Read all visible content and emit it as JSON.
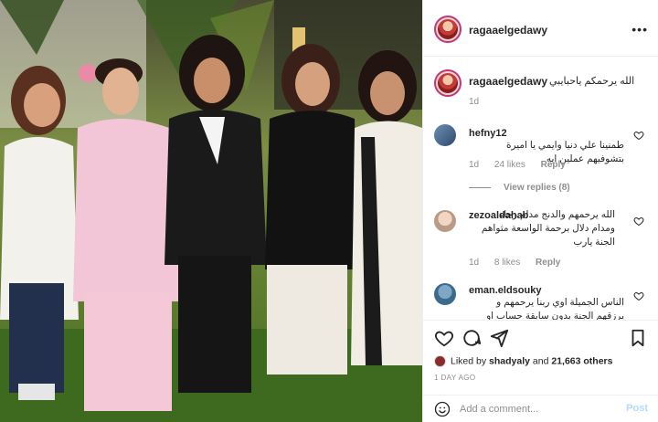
{
  "post": {
    "photo_alt": "",
    "author": "ragaaelgedawy",
    "more_icon": "more-options-icon"
  },
  "caption": {
    "user": "ragaaelgedawy",
    "text": "الله يرحمكم ياحبايبي",
    "time": "1d"
  },
  "comments": [
    {
      "user": "hefny12",
      "text": "طمنينا علي دنيا وايمي يا اميرة بتشوفيهم عملين ايه",
      "time": "1d",
      "likes": "24 likes",
      "reply": "Reply",
      "view_replies": "View replies (8)"
    },
    {
      "user": "zezoaldahab",
      "text": "الله يرحمهم والدنج مدام رحاء ومدام دلال برحمة الواسعة مثواهم الجنة يارب",
      "time": "1d",
      "likes": "8 likes",
      "reply": "Reply"
    },
    {
      "user": "eman.eldsouky",
      "text": "الناس الجميلة اوي ربنا يرحمهم و يرزقهم الجنة بدون سابقة حساب او عذاب"
    }
  ],
  "stats": {
    "liked_prefix": "Liked by",
    "liked_user": "shadyaly",
    "liked_and": "and",
    "liked_others": "21,663 others",
    "time_ago": "1 DAY AGO"
  },
  "add_comment": {
    "placeholder": "Add a comment...",
    "post_label": "Post"
  },
  "colors": {
    "story_ring": "#c13584",
    "post_disabled": "#b3dbff",
    "muted": "#8e8e8e"
  }
}
